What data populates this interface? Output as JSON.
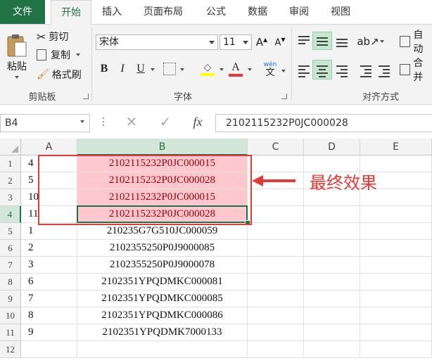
{
  "tabs": [
    "文件",
    "开始",
    "插入",
    "页面布局",
    "公式",
    "数据",
    "审阅",
    "视图"
  ],
  "clipboard": {
    "paste": "粘贴",
    "cut": "剪切",
    "copy": "复制",
    "format_painter": "格式刷",
    "group": "剪贴板"
  },
  "font": {
    "name": "宋体",
    "size": "11",
    "bold": "B",
    "italic": "I",
    "underline": "U",
    "font_color_letter": "A",
    "wen": "wén",
    "wen_char": "文",
    "group": "字体"
  },
  "alignment": {
    "wrap": "自动",
    "merge": "合并",
    "group": "对齐方式"
  },
  "formula_bar": {
    "name_box": "B4",
    "cancel": "✕",
    "enter": "✓",
    "fx": "fx",
    "content": "2102115232P0JC000028"
  },
  "columns": [
    "A",
    "B",
    "C",
    "D",
    "E"
  ],
  "rows": [
    {
      "n": "1",
      "a": "4",
      "b": "2102115232P0JC000015"
    },
    {
      "n": "2",
      "a": "5",
      "b": "2102115232P0JC000028"
    },
    {
      "n": "3",
      "a": "10",
      "b": "2102115232P0JC000015"
    },
    {
      "n": "4",
      "a": "11",
      "b": "2102115232P0JC000028"
    },
    {
      "n": "5",
      "a": "1",
      "b": "210235G7G510JC000059"
    },
    {
      "n": "6",
      "a": "2",
      "b": "2102355250P0J9000085"
    },
    {
      "n": "7",
      "a": "3",
      "b": "2102355250P0J9000078"
    },
    {
      "n": "8",
      "a": "6",
      "b": "2102351YPQDMKC000081"
    },
    {
      "n": "9",
      "a": "7",
      "b": "2102351YPQDMKC000085"
    },
    {
      "n": "10",
      "a": "8",
      "b": "2102351YPQDMKC000086"
    },
    {
      "n": "11",
      "a": "9",
      "b": "2102351YPQDMK7000133"
    },
    {
      "n": "12",
      "a": "",
      "b": ""
    }
  ],
  "annotation": "最终效果",
  "colors": {
    "accent": "#217346",
    "highlight_fill": "#ffc7ce",
    "highlight_text": "#9c0006",
    "annotation": "#e53935"
  }
}
